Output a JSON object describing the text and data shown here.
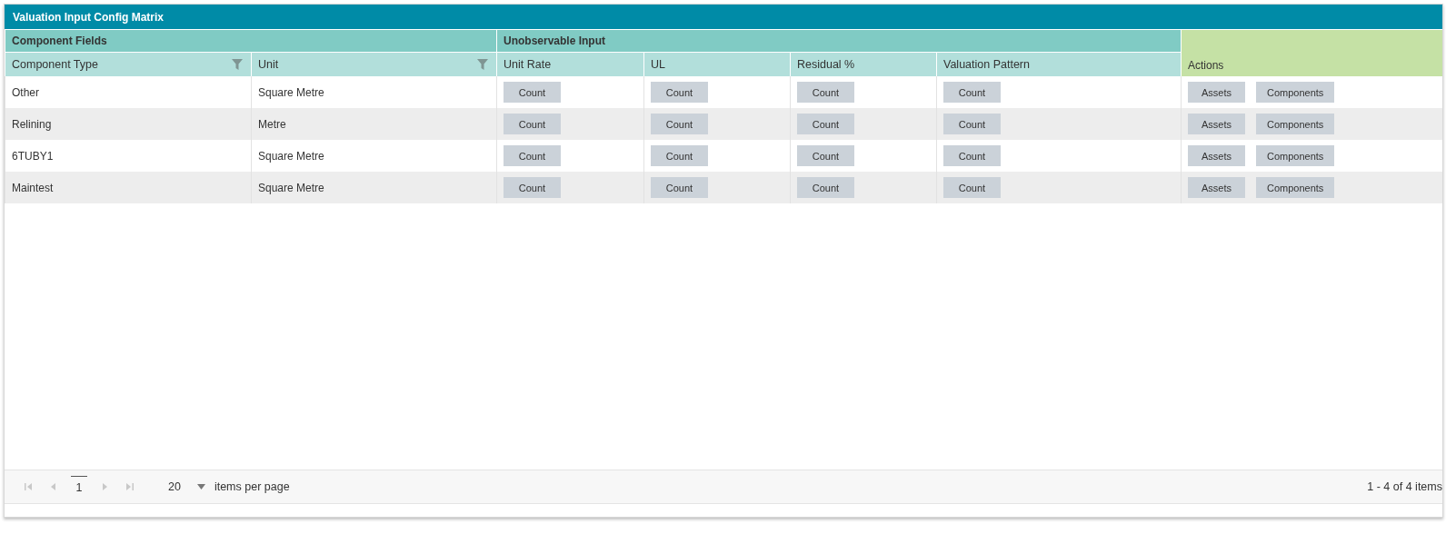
{
  "window": {
    "title": "Valuation Input Config Matrix"
  },
  "groups": [
    {
      "label": "Component Fields",
      "columns": [
        {
          "label": "Component Type",
          "filterable": true
        },
        {
          "label": "Unit",
          "filterable": true
        }
      ]
    },
    {
      "label": "Unobservable Input",
      "columns": [
        {
          "label": "Unit Rate",
          "filterable": false
        },
        {
          "label": "UL",
          "filterable": false
        },
        {
          "label": "Residual %",
          "filterable": false
        },
        {
          "label": "Valuation Pattern",
          "filterable": false
        }
      ]
    }
  ],
  "actions_header": "Actions",
  "rows": [
    {
      "cells": [
        "Other",
        "Square Metre"
      ],
      "inputs": [
        "Count",
        "Count",
        "Count",
        "Count"
      ],
      "actions": [
        "Assets",
        "Components"
      ]
    },
    {
      "cells": [
        "Relining",
        "Metre"
      ],
      "inputs": [
        "Count",
        "Count",
        "Count",
        "Count"
      ],
      "actions": [
        "Assets",
        "Components"
      ]
    },
    {
      "cells": [
        "6TUBY1",
        "Square Metre"
      ],
      "inputs": [
        "Count",
        "Count",
        "Count",
        "Count"
      ],
      "actions": [
        "Assets",
        "Components"
      ]
    },
    {
      "cells": [
        "Maintest",
        "Square Metre"
      ],
      "inputs": [
        "Count",
        "Count",
        "Count",
        "Count"
      ],
      "actions": [
        "Assets",
        "Components"
      ]
    }
  ],
  "pager": {
    "nav": [
      {
        "kind": "first",
        "disabled": true
      },
      {
        "kind": "prev",
        "disabled": true
      },
      {
        "kind": "page",
        "label": "1",
        "selected": true
      },
      {
        "kind": "next",
        "disabled": true
      },
      {
        "kind": "last",
        "disabled": true
      }
    ],
    "page_size": "20",
    "page_size_label": "items per page",
    "summary": "1 - 4 of 4 items"
  }
}
